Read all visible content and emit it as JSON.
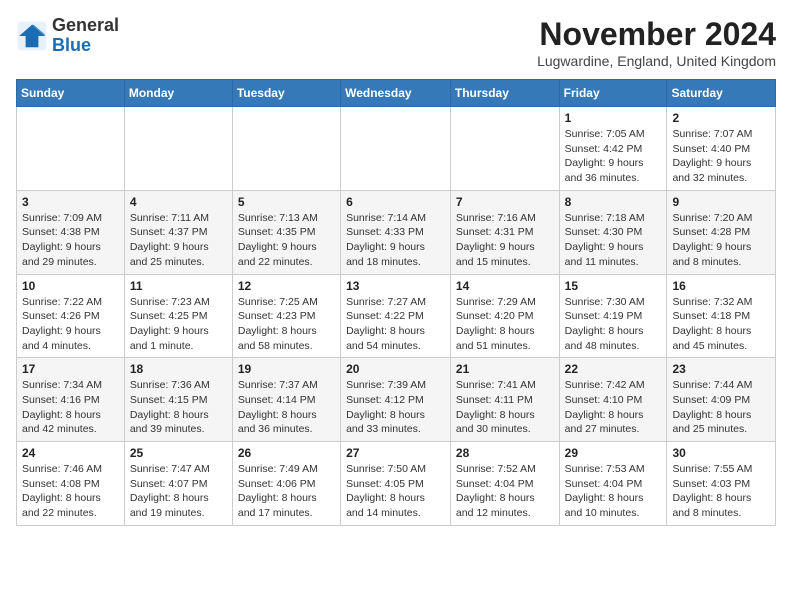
{
  "logo": {
    "general": "General",
    "blue": "Blue"
  },
  "title": "November 2024",
  "location": "Lugwardine, England, United Kingdom",
  "days_of_week": [
    "Sunday",
    "Monday",
    "Tuesday",
    "Wednesday",
    "Thursday",
    "Friday",
    "Saturday"
  ],
  "weeks": [
    [
      {
        "day": "",
        "info": ""
      },
      {
        "day": "",
        "info": ""
      },
      {
        "day": "",
        "info": ""
      },
      {
        "day": "",
        "info": ""
      },
      {
        "day": "",
        "info": ""
      },
      {
        "day": "1",
        "info": "Sunrise: 7:05 AM\nSunset: 4:42 PM\nDaylight: 9 hours and 36 minutes."
      },
      {
        "day": "2",
        "info": "Sunrise: 7:07 AM\nSunset: 4:40 PM\nDaylight: 9 hours and 32 minutes."
      }
    ],
    [
      {
        "day": "3",
        "info": "Sunrise: 7:09 AM\nSunset: 4:38 PM\nDaylight: 9 hours and 29 minutes."
      },
      {
        "day": "4",
        "info": "Sunrise: 7:11 AM\nSunset: 4:37 PM\nDaylight: 9 hours and 25 minutes."
      },
      {
        "day": "5",
        "info": "Sunrise: 7:13 AM\nSunset: 4:35 PM\nDaylight: 9 hours and 22 minutes."
      },
      {
        "day": "6",
        "info": "Sunrise: 7:14 AM\nSunset: 4:33 PM\nDaylight: 9 hours and 18 minutes."
      },
      {
        "day": "7",
        "info": "Sunrise: 7:16 AM\nSunset: 4:31 PM\nDaylight: 9 hours and 15 minutes."
      },
      {
        "day": "8",
        "info": "Sunrise: 7:18 AM\nSunset: 4:30 PM\nDaylight: 9 hours and 11 minutes."
      },
      {
        "day": "9",
        "info": "Sunrise: 7:20 AM\nSunset: 4:28 PM\nDaylight: 9 hours and 8 minutes."
      }
    ],
    [
      {
        "day": "10",
        "info": "Sunrise: 7:22 AM\nSunset: 4:26 PM\nDaylight: 9 hours and 4 minutes."
      },
      {
        "day": "11",
        "info": "Sunrise: 7:23 AM\nSunset: 4:25 PM\nDaylight: 9 hours and 1 minute."
      },
      {
        "day": "12",
        "info": "Sunrise: 7:25 AM\nSunset: 4:23 PM\nDaylight: 8 hours and 58 minutes."
      },
      {
        "day": "13",
        "info": "Sunrise: 7:27 AM\nSunset: 4:22 PM\nDaylight: 8 hours and 54 minutes."
      },
      {
        "day": "14",
        "info": "Sunrise: 7:29 AM\nSunset: 4:20 PM\nDaylight: 8 hours and 51 minutes."
      },
      {
        "day": "15",
        "info": "Sunrise: 7:30 AM\nSunset: 4:19 PM\nDaylight: 8 hours and 48 minutes."
      },
      {
        "day": "16",
        "info": "Sunrise: 7:32 AM\nSunset: 4:18 PM\nDaylight: 8 hours and 45 minutes."
      }
    ],
    [
      {
        "day": "17",
        "info": "Sunrise: 7:34 AM\nSunset: 4:16 PM\nDaylight: 8 hours and 42 minutes."
      },
      {
        "day": "18",
        "info": "Sunrise: 7:36 AM\nSunset: 4:15 PM\nDaylight: 8 hours and 39 minutes."
      },
      {
        "day": "19",
        "info": "Sunrise: 7:37 AM\nSunset: 4:14 PM\nDaylight: 8 hours and 36 minutes."
      },
      {
        "day": "20",
        "info": "Sunrise: 7:39 AM\nSunset: 4:12 PM\nDaylight: 8 hours and 33 minutes."
      },
      {
        "day": "21",
        "info": "Sunrise: 7:41 AM\nSunset: 4:11 PM\nDaylight: 8 hours and 30 minutes."
      },
      {
        "day": "22",
        "info": "Sunrise: 7:42 AM\nSunset: 4:10 PM\nDaylight: 8 hours and 27 minutes."
      },
      {
        "day": "23",
        "info": "Sunrise: 7:44 AM\nSunset: 4:09 PM\nDaylight: 8 hours and 25 minutes."
      }
    ],
    [
      {
        "day": "24",
        "info": "Sunrise: 7:46 AM\nSunset: 4:08 PM\nDaylight: 8 hours and 22 minutes."
      },
      {
        "day": "25",
        "info": "Sunrise: 7:47 AM\nSunset: 4:07 PM\nDaylight: 8 hours and 19 minutes."
      },
      {
        "day": "26",
        "info": "Sunrise: 7:49 AM\nSunset: 4:06 PM\nDaylight: 8 hours and 17 minutes."
      },
      {
        "day": "27",
        "info": "Sunrise: 7:50 AM\nSunset: 4:05 PM\nDaylight: 8 hours and 14 minutes."
      },
      {
        "day": "28",
        "info": "Sunrise: 7:52 AM\nSunset: 4:04 PM\nDaylight: 8 hours and 12 minutes."
      },
      {
        "day": "29",
        "info": "Sunrise: 7:53 AM\nSunset: 4:04 PM\nDaylight: 8 hours and 10 minutes."
      },
      {
        "day": "30",
        "info": "Sunrise: 7:55 AM\nSunset: 4:03 PM\nDaylight: 8 hours and 8 minutes."
      }
    ]
  ]
}
